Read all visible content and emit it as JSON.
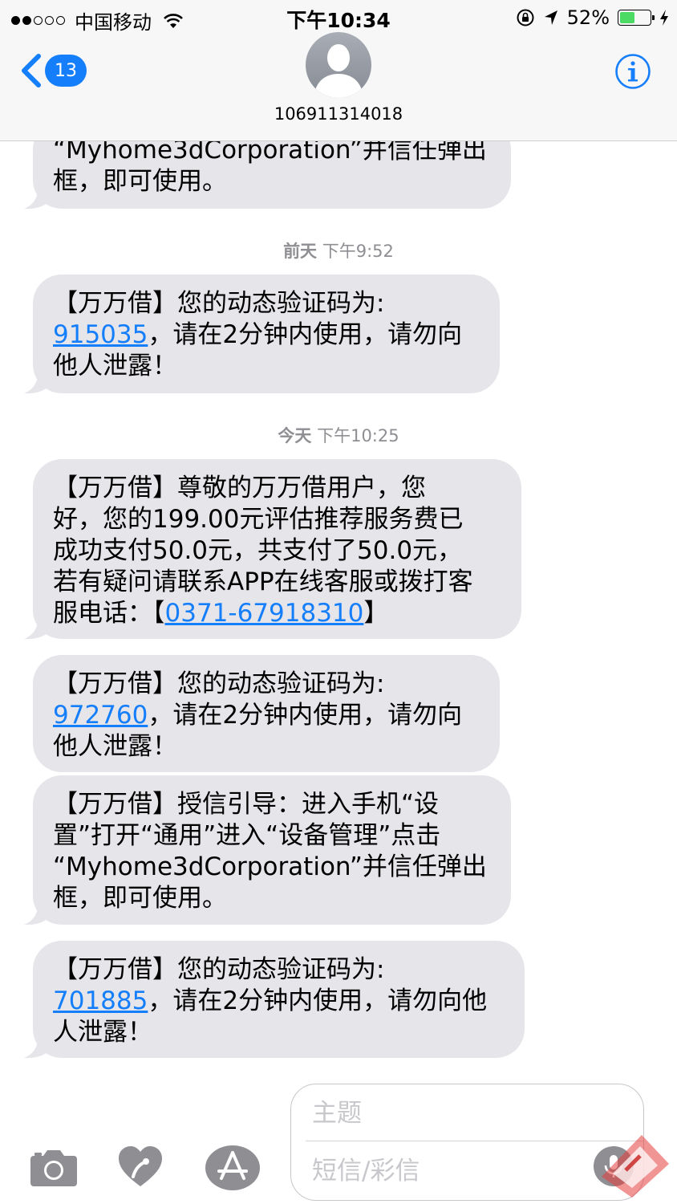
{
  "status_bar": {
    "carrier": "中国移动",
    "time": "下午10:34",
    "battery_percent": "52%",
    "battery_level": 0.52,
    "signal_bars_filled": 2,
    "signal_bars_total": 5
  },
  "header": {
    "back_badge": "13",
    "contact": "106911314018"
  },
  "messages": {
    "top_partial": {
      "line1": "“Myhome3dCorporation”并信任弹出",
      "line2": "框，即可使用。"
    },
    "ts1": {
      "day": "前天",
      "time": "下午9:52"
    },
    "m1": {
      "line1": "【万万借】您的动态验证码为:",
      "code": "915035",
      "line2_rest": "，请在2分钟内使用，请勿向",
      "line3": "他人泄露！"
    },
    "ts2": {
      "day": "今天",
      "time": "下午10:25"
    },
    "m2": {
      "line1": "【万万借】尊敬的万万借用户，您",
      "line2": "好，您的199.00元评估推荐服务费已",
      "line3": "成功支付50.0元，共支付了50.0元，",
      "line4": "若有疑问请联系APP在线客服或拨打客",
      "line5_pre": "服电话：【",
      "phone": "0371-67918310",
      "line5_post": "】"
    },
    "m3": {
      "line1": "【万万借】您的动态验证码为:",
      "code": "972760",
      "line2_rest": "，请在2分钟内使用，请勿向",
      "line3": "他人泄露！"
    },
    "m4": {
      "line1": "【万万借】授信引导：进入手机“设",
      "line2": "置”打开“通用”进入“设备管理”点击",
      "line3": "“Myhome3dCorporation”并信任弹出",
      "line4": "框，即可使用。"
    },
    "m5": {
      "line1": "【万万借】您的动态验证码为:",
      "code": "701885",
      "line2_rest": "，请在2分钟内使用，请勿向他",
      "line3": "人泄露！"
    }
  },
  "input": {
    "subject_placeholder": "主题",
    "message_placeholder": "短信/彩信"
  },
  "colors": {
    "bubble_gray": "#e5e5ea",
    "ios_blue": "#157efb",
    "battery_green": "#4cd964",
    "placeholder_gray": "#c7c7cc"
  }
}
